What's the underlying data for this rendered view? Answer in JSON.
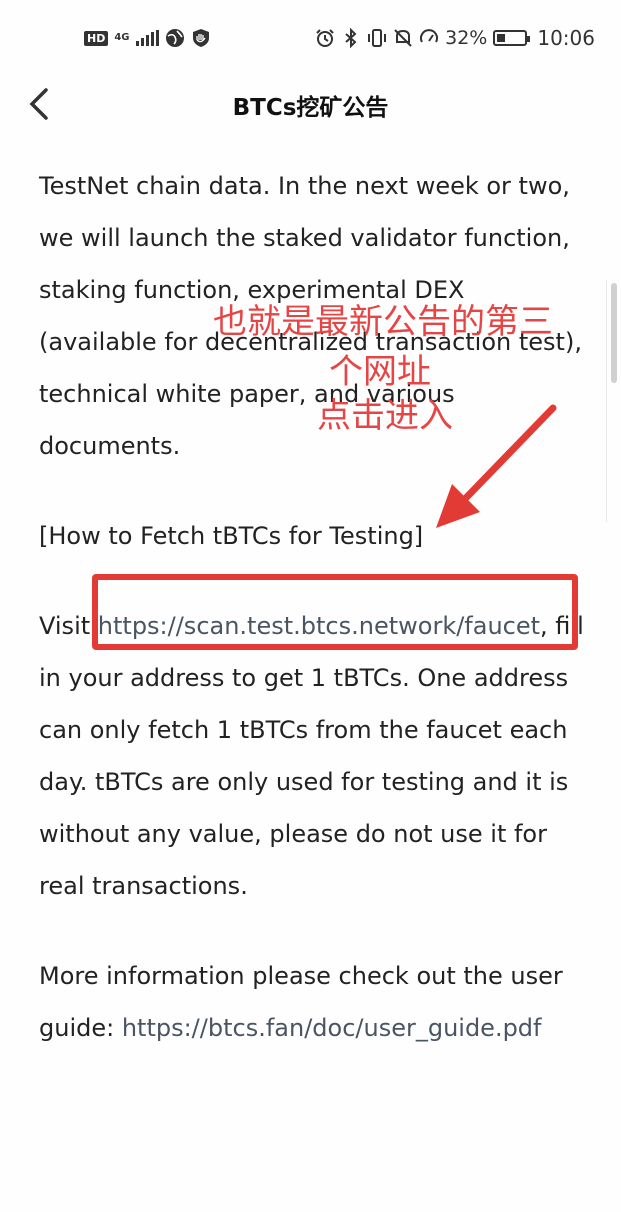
{
  "status_bar": {
    "hd": "HD",
    "network": "4G",
    "battery_text": "32%",
    "battery_level": 0.32,
    "time": "10:06"
  },
  "header": {
    "title": "BTCs挖矿公告"
  },
  "content": {
    "para1": "TestNet chain data. In the next week or two, we will launch the staked validator function, staking function, experimental DEX (available for decentralized transaction test), technical white paper, and various documents.",
    "heading": "[How to Fetch tBTCs for Testing]",
    "visit_prefix": "Visit ",
    "faucet_link": "https://scan.test.btcs.network/faucet",
    "visit_suffix": ", fill in your address to get 1 tBTCs. One address can only fetch 1 tBTCs from the faucet each day. tBTCs are only used for testing and it is without any value, please do not use it for real transactions.",
    "more_info_prefix": "More information please check out the user guide: ",
    "guide_link": "https://btcs.fan/doc/user_guide.pdf"
  },
  "annotation": {
    "line1": "也就是最新公告的第三",
    "line2": "个网址",
    "line3": "点击进入",
    "color": "#e64545"
  }
}
